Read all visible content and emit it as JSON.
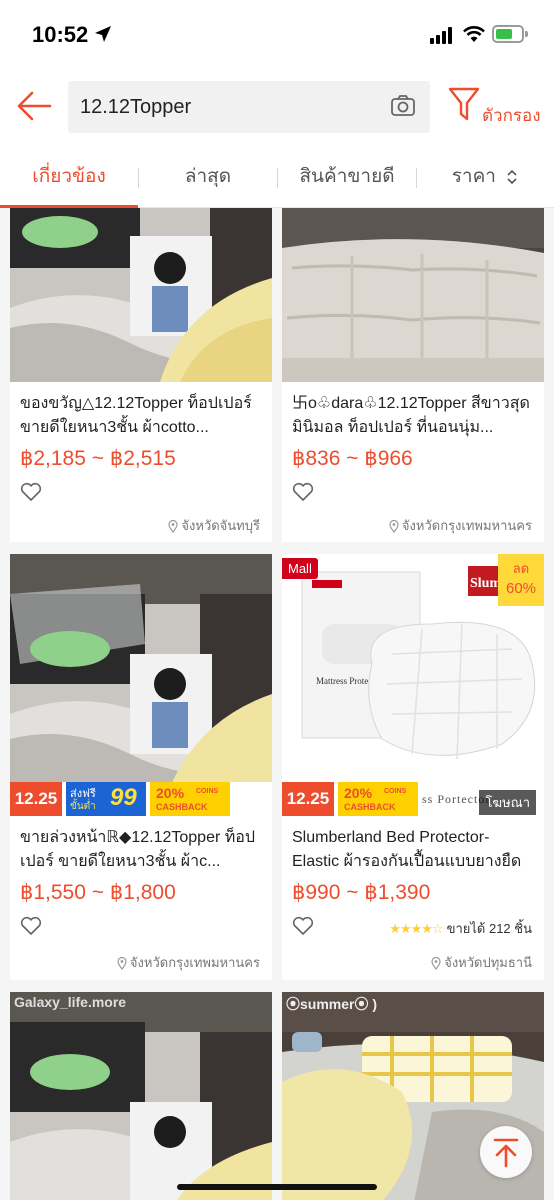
{
  "status_bar": {
    "time": "10:52"
  },
  "header": {
    "search_value": "12.12Topper",
    "filter_label": "ตัวกรอง"
  },
  "tabs": [
    {
      "label": "เกี่ยวข้อง",
      "active": true
    },
    {
      "label": "ล่าสุด"
    },
    {
      "label": "สินค้าขายดี"
    },
    {
      "label": "ราคา"
    }
  ],
  "products": [
    {
      "title": "ของขวัญ△12.12Topper ท็อปเปอร์ ขายดีใยหนา3ชั้น ผ้าcotto...",
      "price": "฿2,185 ~ ฿2,515",
      "location": "จังหวัดจันทบุรี"
    },
    {
      "title": "卐o♧dara♧12.12Topper สีขาวสุดมินิมอล ท็อปเปอร์ ที่นอนนุ่ม...",
      "price": "฿836 ~ ฿966",
      "location": "จังหวัดกรุงเทพมหานคร"
    },
    {
      "title": "ขายล่วงหน้าℝ◆12.12Topper ท็อปเปอร์ ขายดีใยหนา3ชั้น ผ้าc...",
      "price": "฿1,550 ~ ฿1,800",
      "location": "จังหวัดกรุงเทพมหานคร",
      "banner": {
        "date": "12.25",
        "free_ship_top": "ส่งฟรี",
        "free_ship_bottom": "ขั้นต่ำ",
        "free_ship_value": "99",
        "coins_pct": "20%",
        "coins_top": "COINS",
        "coins_bottom": "CASHBACK"
      }
    },
    {
      "title": "Slumberland Bed Protector-Elastic ผ้ารองกันเปื้อนแบบยางยืด",
      "price": "฿990 ~ ฿1,390",
      "location": "จังหวัดปทุมธานี",
      "sold": "ขายได้ 212 ชิ้น",
      "rating": 4.5,
      "mall_label": "Mall",
      "discount_top": "ลด",
      "discount_value": "60%",
      "ad_label": "โฆษณา",
      "brand": "Slumber",
      "package_text": "Mattress Protector",
      "banner_text": "ss Portector",
      "banner": {
        "date": "12.25",
        "coins_pct": "20%",
        "coins_top": "COINS",
        "coins_bottom": "CASHBACK"
      }
    },
    {
      "watermark": "Galaxy_life.more"
    },
    {
      "watermark": "⦿summer⦿ )"
    }
  ],
  "colors": {
    "accent": "#ee4d2d",
    "mall": "#d0011b",
    "discount_bg": "#ffd839",
    "coins": "#ffd000",
    "free_ship": "#1a64d6"
  }
}
